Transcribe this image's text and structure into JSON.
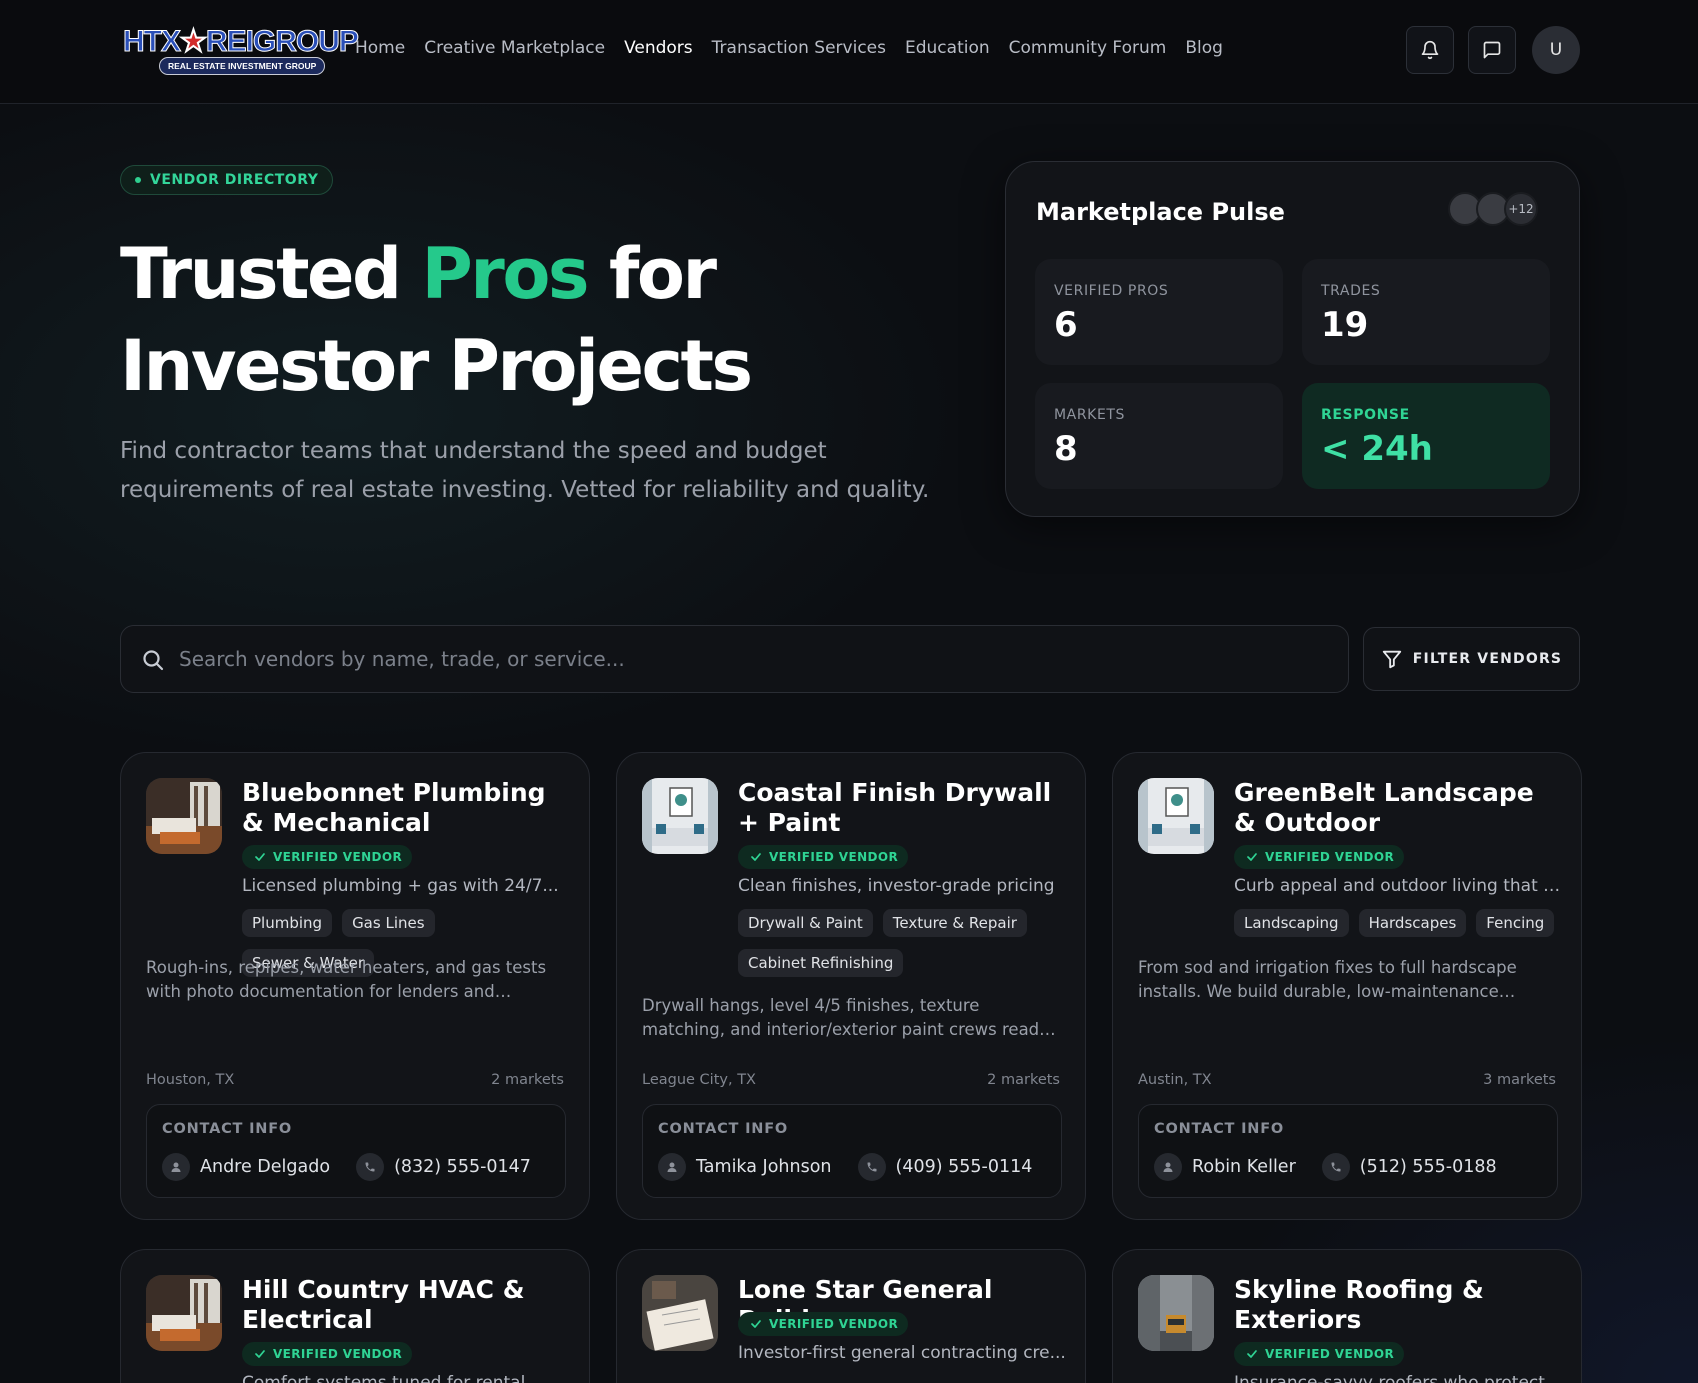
{
  "logo": {
    "top_a": "HTX",
    "top_b": "REIGROUP",
    "bottom": "REAL ESTATE INVESTMENT GROUP"
  },
  "nav": [
    "Home",
    "Creative Marketplace",
    "Vendors",
    "Transaction Services",
    "Education",
    "Community Forum",
    "Blog"
  ],
  "nav_active": "Vendors",
  "user_initial": "U",
  "hero": {
    "badge": "VENDOR DIRECTORY",
    "title_a": "Trusted ",
    "title_accent": "Pros",
    "title_b": " for",
    "title_line2": "Investor Projects",
    "subtitle": "Find contractor teams that understand the speed and budget requirements of real estate investing. Vetted for reliability and quality."
  },
  "pulse": {
    "title": "Marketplace Pulse",
    "avatars_more": "+12",
    "stats": [
      {
        "label": "VERIFIED PROS",
        "value": "6"
      },
      {
        "label": "TRADES",
        "value": "19"
      },
      {
        "label": "MARKETS",
        "value": "8"
      },
      {
        "label": "RESPONSE",
        "value": "< 24h"
      }
    ]
  },
  "search": {
    "placeholder": "Search vendors by name, trade, or service..."
  },
  "filter_label": "FILTER VENDORS",
  "contact_label": "CONTACT INFO",
  "verified_label": "VERIFIED VENDOR",
  "vendors": [
    {
      "name": "Bluebonnet Plumbing & Mechanical",
      "tagline": "Licensed plumbing + gas with 24/7...",
      "tags": [
        "Plumbing",
        "Gas Lines",
        "Sewer & Water"
      ],
      "desc": "Rough-ins, repipes, water heaters, and gas tests with photo documentation for lenders and inspectors.",
      "location": "Houston, TX",
      "markets": "2 markets",
      "contact": "Andre Delgado",
      "phone": "(832) 555-0147"
    },
    {
      "name": "Coastal Finish Drywall + Paint",
      "tagline": "Clean finishes, investor-grade pricing",
      "tags": [
        "Drywall & Paint",
        "Texture & Repair",
        "Cabinet Refinishing"
      ],
      "desc": "Drywall hangs, level 4/5 finishes, texture matching, and interior/exterior paint crews ready for quick...",
      "location": "League City, TX",
      "markets": "2 markets",
      "contact": "Tamika Johnson",
      "phone": "(409) 555-0114"
    },
    {
      "name": "GreenBelt Landscape & Outdoor",
      "tagline": "Curb appeal and outdoor living that s...",
      "tags": [
        "Landscaping",
        "Hardscapes",
        "Fencing"
      ],
      "desc": "From sod and irrigation fixes to full hardscape installs. We build durable, low-maintenance exterio...",
      "location": "Austin, TX",
      "markets": "3 markets",
      "contact": "Robin Keller",
      "phone": "(512) 555-0188"
    },
    {
      "name": "Hill Country HVAC & Electrical",
      "tagline": "Comfort systems tuned for rental..."
    },
    {
      "name": "Lone Star General Builders",
      "tagline": "Investor-first general contracting cre..."
    },
    {
      "name": "Skyline Roofing & Exteriors",
      "tagline": "Insurance-savvy roofers who protect..."
    }
  ]
}
